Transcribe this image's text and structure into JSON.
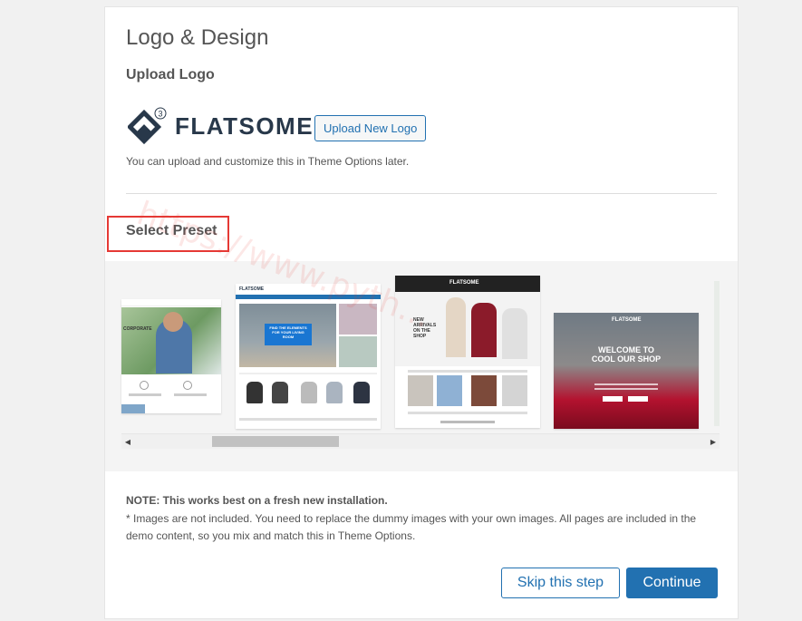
{
  "header": {
    "title": "Logo & Design"
  },
  "upload": {
    "label": "Upload Logo",
    "logo_text": "FLATSOME",
    "logo_badge": "3",
    "button_label": "Upload New Logo",
    "hint": "You can upload and customize this in Theme Options later."
  },
  "preset": {
    "label": "Select Preset",
    "thumbs": [
      {
        "caption": "CORPORATE"
      },
      {
        "caption": "FIND THE ELEMENTS FOR YOUR LIVING ROOM",
        "brand": "FLATSOME"
      },
      {
        "caption": "NEW ARRIVALS ON THE SHOP",
        "brand": "FLATSOME"
      },
      {
        "caption": "WELCOME TO COOL OUR SHOP",
        "brand": "FLATSOME"
      }
    ]
  },
  "note": {
    "bold": "NOTE: This works best on a fresh new installation.",
    "text": "* Images are not included. You need to replace the dummy images with your own images. All pages are included in the demo content, so you mix and match this in Theme Options."
  },
  "actions": {
    "skip_label": "Skip this step",
    "continue_label": "Continue"
  },
  "watermark": {
    "text": "https://www.pyth..."
  },
  "colors": {
    "accent": "#2271b1",
    "highlight": "#e53935",
    "logo": "#28384a"
  }
}
